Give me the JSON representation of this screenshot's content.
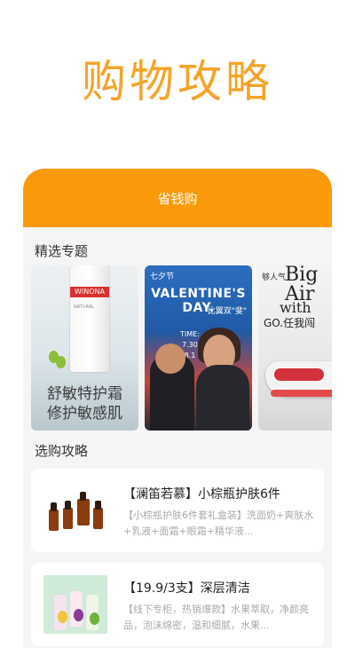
{
  "hero": {
    "title": "购物攻略"
  },
  "card": {
    "header": "省钱购"
  },
  "sections": {
    "topics_title": "精选专题",
    "guides_title": "选购攻略"
  },
  "topics": [
    {
      "brand": "WINONA",
      "line1": "舒敏特护霜",
      "line2": "修护敏感肌"
    },
    {
      "top": "七夕节",
      "title": "VALENTINE'S DAY.",
      "subtitle": "比翼双\"斐\"",
      "time_label": "TIME:",
      "time_start": "7.30",
      "time_end": "8.1"
    },
    {
      "small": "够人气",
      "big": "Big Air",
      "with": "with",
      "go": "GO.任我闯"
    }
  ],
  "guides": [
    {
      "title": "【澜笛若慕】小棕瓶护肤6件",
      "desc": "【小棕瓶护肤6件套礼盒装】洗面奶+爽肤水+乳液+面霜+眼霜+精华液..."
    },
    {
      "title": "【19.9/3支】深层清洁",
      "desc": "【线下专柜，热销爆款】水果萃取，净颜亮品，泡沫绵密，温和细腻，水果..."
    }
  ],
  "colors": {
    "accent": "#fa9a0a",
    "hero_title": "#f4a428"
  }
}
